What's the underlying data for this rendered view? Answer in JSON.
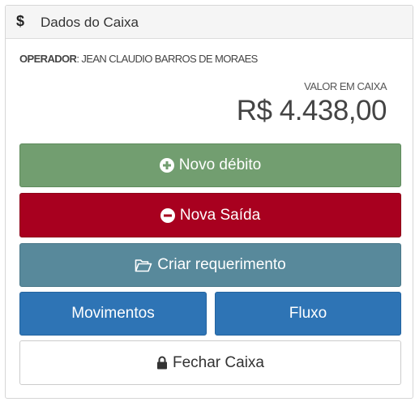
{
  "header": {
    "icon": "dollar-icon",
    "icon_glyph": "$",
    "title": "Dados do Caixa"
  },
  "operator": {
    "label": "OPERADOR",
    "separator": ":",
    "name": "JEAN CLAUDIO BARROS DE MORAES"
  },
  "cash": {
    "label": "VALOR EM CAIXA",
    "value": "R$ 4.438,00"
  },
  "buttons": {
    "novo_debito": {
      "label": "Novo débito",
      "icon": "plus-circle-icon",
      "color": "#729e70"
    },
    "nova_saida": {
      "label": "Nova Saída",
      "icon": "minus-circle-icon",
      "color": "#a8001f"
    },
    "criar_requerimento": {
      "label": "Criar requerimento",
      "icon": "folder-open-icon",
      "color": "#58899b"
    },
    "movimentos": {
      "label": "Movimentos",
      "color": "#2e74b5"
    },
    "fluxo": {
      "label": "Fluxo",
      "color": "#2e74b5"
    },
    "fechar_caixa": {
      "label": "Fechar Caixa",
      "icon": "lock-icon",
      "color": "#ffffff"
    }
  }
}
